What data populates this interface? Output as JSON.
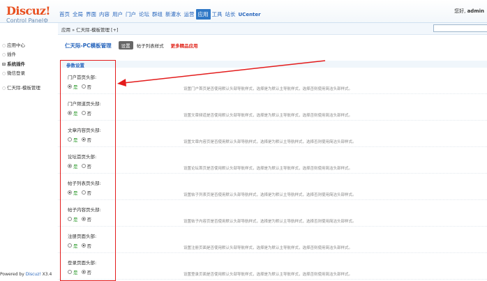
{
  "header": {
    "logo_main": "Discuz!",
    "logo_sub": "Control Panel",
    "nav": [
      "首页",
      "全局",
      "界面",
      "内容",
      "用户",
      "门户",
      "论坛",
      "群组",
      "新灌水",
      "运营",
      "应用",
      "工具",
      "站长",
      "UCenter"
    ],
    "active_nav_index": 10,
    "greeting": "您好,",
    "username": "admin"
  },
  "breadcrumb": {
    "text": "应用 » 仁天际-模板管理",
    "plus": "[+]"
  },
  "sidebar": {
    "items": [
      "应用中心",
      "插件",
      "系统插件",
      "微信登录",
      "仁天际-模板管理"
    ],
    "powered_by": "Powered by ",
    "powered_brand": "Discuz!",
    "powered_version": " X3.4"
  },
  "main": {
    "plugin_title": "仁天际-PC模板管理",
    "tab_active": "设置",
    "tab_other": "帖子列表样式",
    "tab_more": "更多精品应用",
    "section_title": "参数设置",
    "settings": [
      {
        "label": "门户首页头部:",
        "selected": "yes",
        "desc": "设置门户首页是否使用默认头部导航样式，选择是为默认主导航样式，选择否则使用简洁头部样式。"
      },
      {
        "label": "门户频道页头部:",
        "selected": "yes",
        "desc": "设置文章频道是否使用默认头部导航样式，选择是为默认主导航样式，选择否则使用简洁头部样式。"
      },
      {
        "label": "文章内容页头部:",
        "selected": "no",
        "desc": "设置文章内容页是否使用默认头部导航样式，选择是为默认主导航样式，选择否则使用简洁头部样式。"
      },
      {
        "label": "论坛首页头部:",
        "selected": "yes",
        "desc": "设置论坛首页是否使用默认头部导航样式，选择是为默认主导航样式，选择否则使用简洁头部样式。"
      },
      {
        "label": "帖子列表页头部:",
        "selected": "yes",
        "desc": "设置帖子列表页是否使用默认头部导航样式，选择是为默认主导航样式，选择否则使用简洁头部样式。"
      },
      {
        "label": "帖子内容页头部:",
        "selected": "no",
        "desc": "设置帖子内容页是否使用默认头部导航样式，选择是为默认主导航样式，选择否则使用简洁头部样式。"
      },
      {
        "label": "注册页面头部:",
        "selected": "no",
        "desc": "设置注册页面是否使用默认头部导航样式，选择是为默认主导航样式，选择否则使用简洁头部样式。"
      },
      {
        "label": "登录页面头部:",
        "selected": "no",
        "desc": "设置登录页面是否使用默认头部导航样式，选择是为默认主导航样式，选择否则使用简洁头部样式。"
      }
    ],
    "yes_label": "是",
    "no_label": "否"
  },
  "colors": {
    "annotation": "#e31b1b",
    "nav_active": "#2f78c6",
    "link": "#2866bd",
    "yes": "#2a9a2a"
  },
  "icons": [
    "gear-icon",
    "radio-icon",
    "arrow-annotation"
  ]
}
